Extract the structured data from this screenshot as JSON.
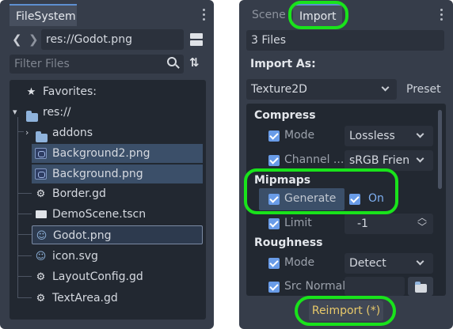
{
  "filesystem": {
    "tab_label": "FileSystem",
    "path": "res://Godot.png",
    "filter_placeholder": "Filter Files",
    "tree": {
      "favorites": "Favorites:",
      "root": "res://",
      "items": [
        {
          "label": "addons",
          "icon": "folder-icon"
        },
        {
          "label": "Background2.png",
          "icon": "image-file-icon"
        },
        {
          "label": "Background.png",
          "icon": "image-file-icon"
        },
        {
          "label": "Border.gd",
          "icon": "gear-icon"
        },
        {
          "label": "DemoScene.tscn",
          "icon": "clapperboard-icon"
        },
        {
          "label": "Godot.png",
          "icon": "godot-logo-icon"
        },
        {
          "label": "icon.svg",
          "icon": "godot-logo-icon"
        },
        {
          "label": "LayoutConfig.gd",
          "icon": "gear-icon"
        },
        {
          "label": "TextArea.gd",
          "icon": "gear-icon"
        }
      ]
    }
  },
  "import_dock": {
    "tabs": [
      "Scene",
      "Import"
    ],
    "files_count": "3 Files",
    "import_as_label": "Import As:",
    "import_type": "Texture2D",
    "preset_label": "Preset",
    "sections": {
      "compress": "Compress",
      "mipmaps": "Mipmaps",
      "roughness": "Roughness"
    },
    "properties": {
      "mode_label": "Mode",
      "mode_value": "Lossless",
      "channel_label": "Channel ...",
      "channel_value": "sRGB Frien",
      "generate_label": "Generate",
      "generate_value": "On",
      "limit_label": "Limit",
      "limit_value": "-1",
      "rough_mode_label": "Mode",
      "rough_mode_value": "Detect",
      "src_normal_label": "Src Normal"
    },
    "reimport_label": "Reimport (*)"
  },
  "colors": {
    "highlight": "#19e31b",
    "accent": "#699ce8",
    "panel": "#363d4a"
  }
}
